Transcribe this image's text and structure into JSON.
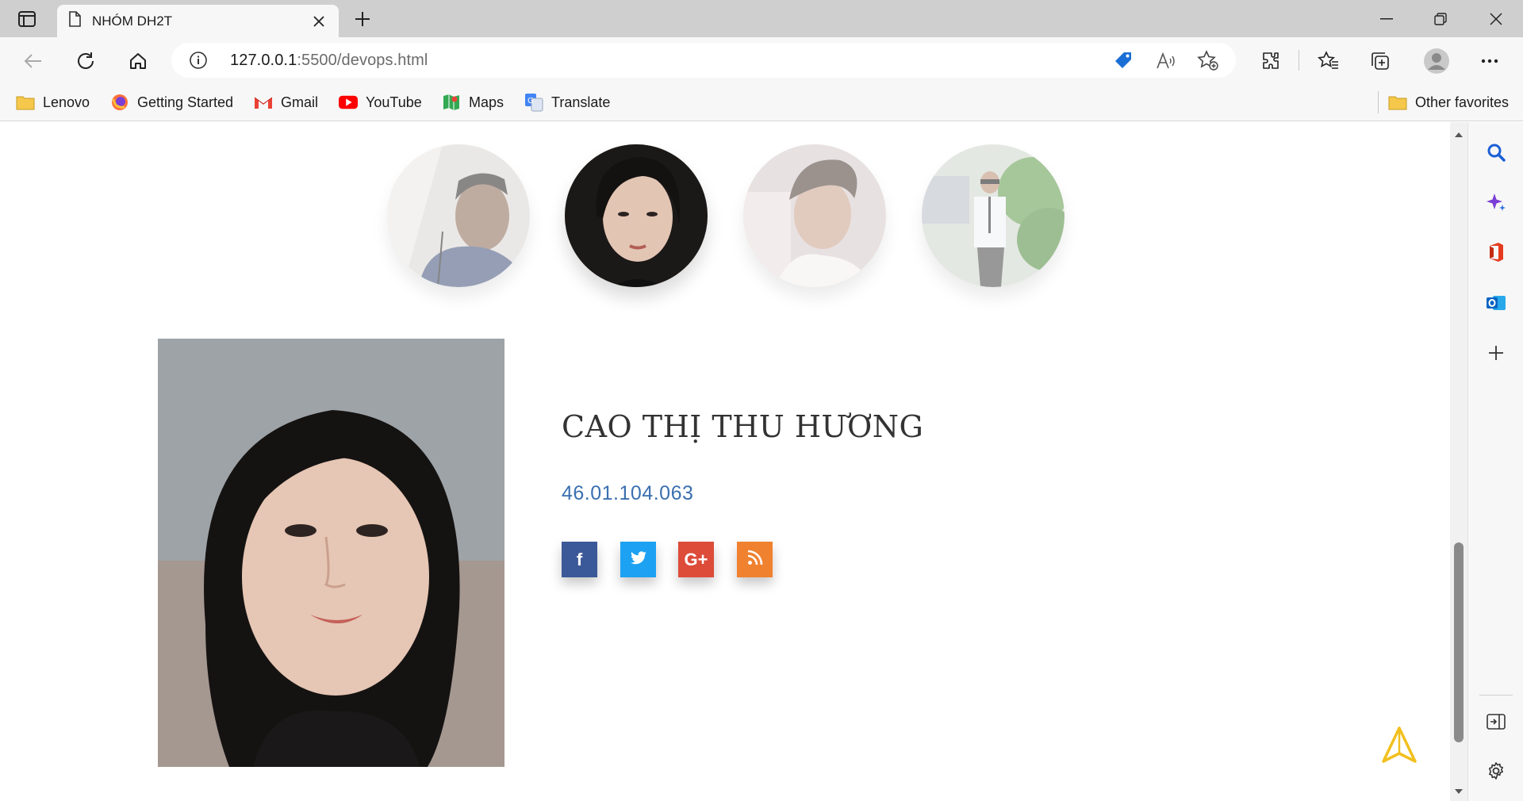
{
  "browser": {
    "tab_title": "NHÓM DH2T",
    "url_host": "127.0.0.1",
    "url_rest": ":5500/devops.html",
    "bookmarks": [
      "Lenovo",
      "Getting Started",
      "Gmail",
      "YouTube",
      "Maps",
      "Translate"
    ],
    "other_favorites": "Other favorites"
  },
  "members": {
    "count": 4,
    "active_index": 2
  },
  "profile": {
    "name": "CAO THỊ THU HƯƠNG",
    "student_id": "46.01.104.063",
    "social": [
      {
        "name": "facebook",
        "glyph": "f",
        "color": "#3b5998"
      },
      {
        "name": "twitter",
        "glyph": "",
        "color": "#1da1f2"
      },
      {
        "name": "google-plus",
        "glyph": "G+",
        "color": "#dd4b39"
      },
      {
        "name": "rss",
        "glyph": "",
        "color": "#f0812f"
      }
    ]
  },
  "colors": {
    "accent_link": "#3a6fb0",
    "back_to_top": "#f2c01e"
  }
}
